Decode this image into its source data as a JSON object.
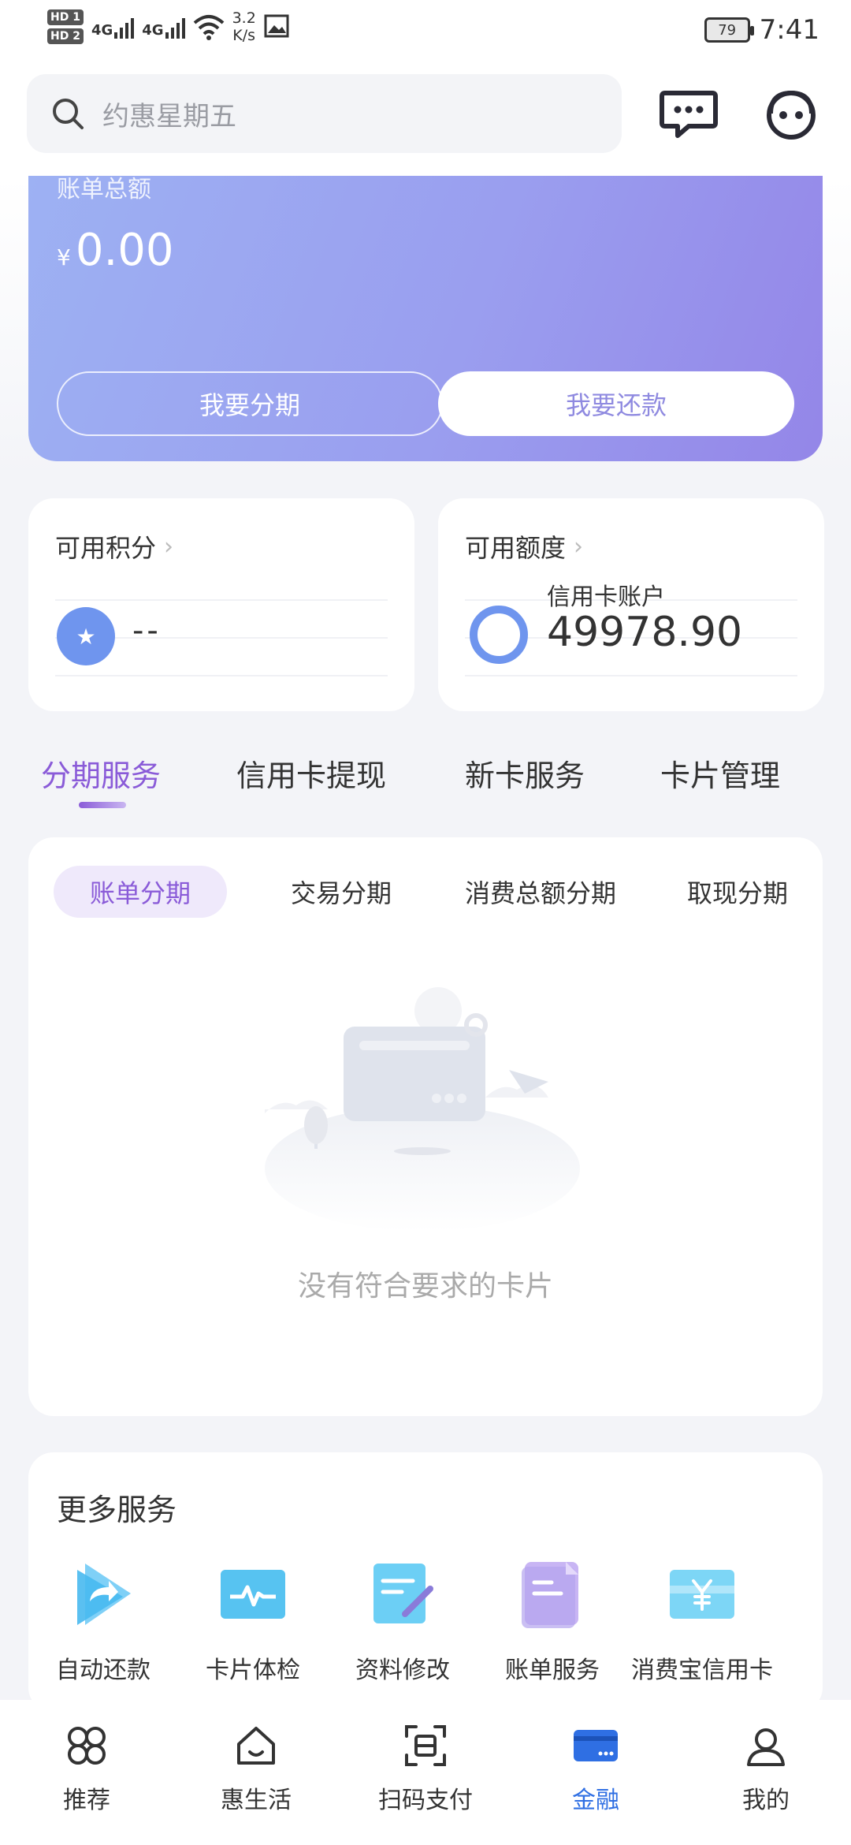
{
  "status_bar": {
    "hd1": "HD 1",
    "hd2": "HD 2",
    "net1": "4G",
    "net2": "4G",
    "speed_value": "3.2",
    "speed_unit": "K/s",
    "battery": "79",
    "time": "7:41"
  },
  "header": {
    "search_placeholder": "约惠星期五"
  },
  "bill": {
    "label": "账单总额",
    "currency": "¥",
    "amount": "0.00",
    "installment_button": "我要分期",
    "repay_button": "我要还款"
  },
  "points_card": {
    "title": "可用积分",
    "value": "--"
  },
  "credit_card": {
    "title": "可用额度",
    "subtitle": "信用卡账户",
    "value": "49978.90"
  },
  "main_tabs": [
    {
      "label": "分期服务",
      "active": true
    },
    {
      "label": "信用卡提现",
      "active": false
    },
    {
      "label": "新卡服务",
      "active": false
    },
    {
      "label": "卡片管理",
      "active": false
    }
  ],
  "sub_tabs": [
    {
      "label": "账单分期",
      "active": true
    },
    {
      "label": "交易分期",
      "active": false
    },
    {
      "label": "消费总额分期",
      "active": false
    },
    {
      "label": "取现分期",
      "active": false
    }
  ],
  "empty_state": {
    "text": "没有符合要求的卡片"
  },
  "more_services": {
    "title": "更多服务",
    "items": [
      {
        "label": "自动还款",
        "icon": "auto-repay-icon"
      },
      {
        "label": "卡片体检",
        "icon": "card-checkup-icon"
      },
      {
        "label": "资料修改",
        "icon": "edit-profile-icon"
      },
      {
        "label": "账单服务",
        "icon": "bill-service-icon"
      },
      {
        "label": "消费宝信用卡",
        "icon": "yen-card-icon"
      }
    ]
  },
  "bottom_nav": [
    {
      "label": "推荐",
      "icon": "clover-icon",
      "active": false
    },
    {
      "label": "惠生活",
      "icon": "home-icon",
      "active": false
    },
    {
      "label": "扫码支付",
      "icon": "scan-icon",
      "active": false
    },
    {
      "label": "金融",
      "icon": "card-icon",
      "active": true
    },
    {
      "label": "我的",
      "icon": "user-icon",
      "active": false
    }
  ],
  "colors": {
    "accent_purple": "#8a5bd8",
    "nav_active_blue": "#2f6fe3",
    "bill_gradient_start": "#9db1f3",
    "bill_gradient_end": "#9486e8"
  }
}
